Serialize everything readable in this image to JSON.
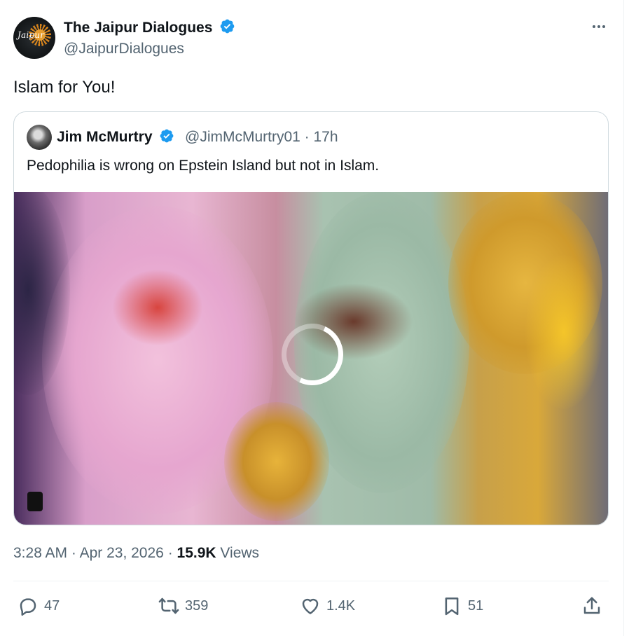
{
  "author": {
    "avatar_text": "Jaipur",
    "display_name": "The Jaipur Dialogues",
    "handle": "@JaipurDialogues"
  },
  "tweet": {
    "text": "Islam for You!"
  },
  "quote": {
    "display_name": "Jim McMurtry",
    "handle": "@JimMcMurtry01",
    "age": "17h",
    "text": "Pedophilia is wrong on Epstein Island but not in Islam."
  },
  "meta": {
    "time": "3:28 AM",
    "date": "Apr 23, 2026",
    "views_count": "15.9K",
    "views_label": "Views"
  },
  "actions": {
    "replies": "47",
    "reposts": "359",
    "likes": "1.4K",
    "bookmarks": "51"
  },
  "colors": {
    "verified": "#1d9bf0",
    "secondary_text": "#536471",
    "border": "#cfd9de"
  },
  "icons": [
    "verified-badge-icon",
    "more-icon",
    "reply-icon",
    "repost-icon",
    "like-icon",
    "bookmark-icon",
    "share-icon"
  ]
}
